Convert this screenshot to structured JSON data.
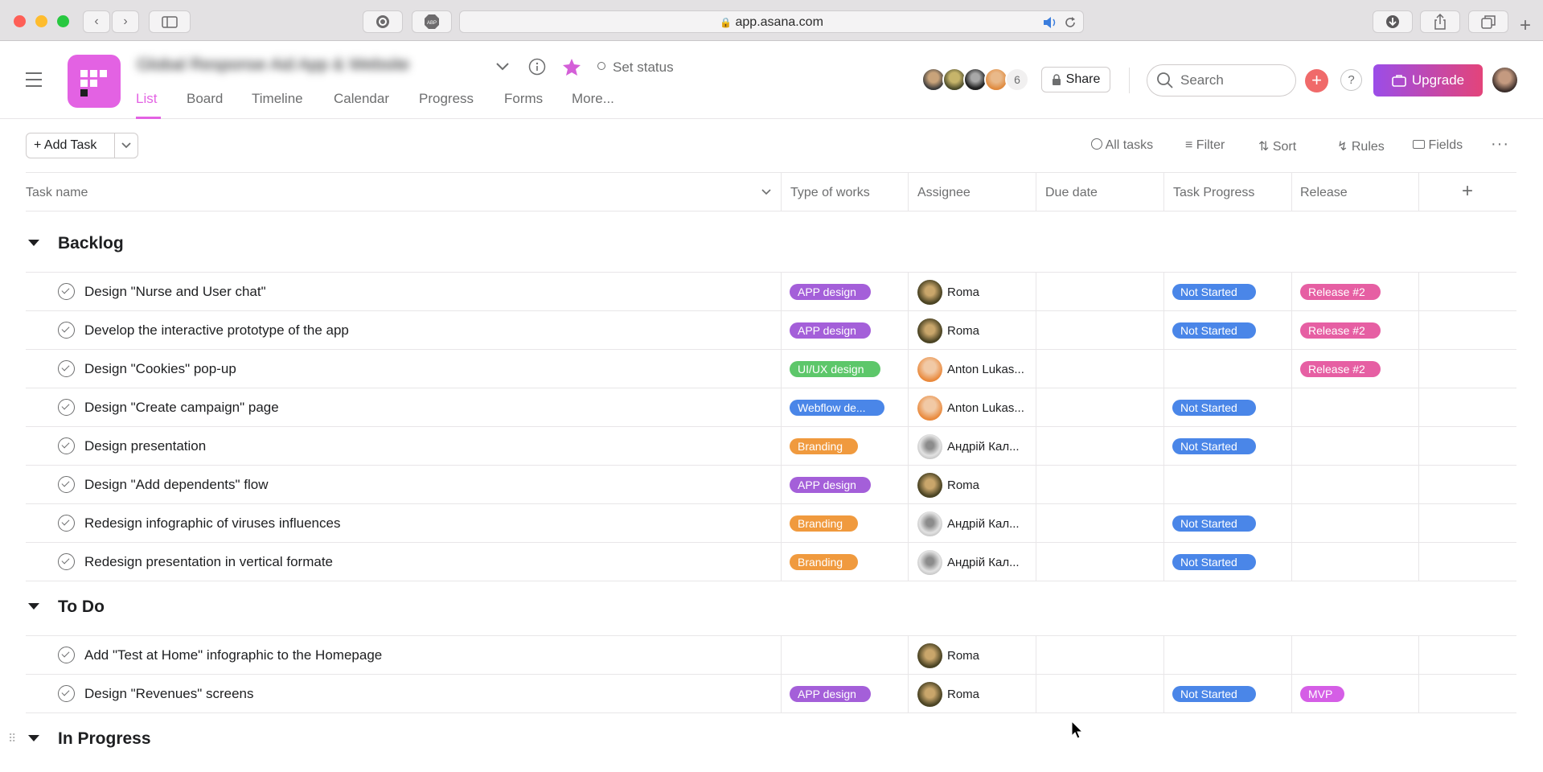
{
  "browser": {
    "url": "app.asana.com",
    "nav": {
      "back": "‹",
      "forward": "›"
    }
  },
  "header": {
    "project_name": "Global Response Aid App & Website",
    "set_status": "Set status",
    "tabs": [
      "List",
      "Board",
      "Timeline",
      "Calendar",
      "Progress",
      "Forms",
      "More..."
    ],
    "active_tab": "List",
    "member_count": "6",
    "share_label": "Share",
    "search_placeholder": "Search",
    "upgrade_label": "Upgrade",
    "help_label": "?"
  },
  "toolbar": {
    "add_task_label": "Add Task",
    "all_tasks": "All tasks",
    "filter": "Filter",
    "sort": "Sort",
    "rules": "Rules",
    "fields": "Fields"
  },
  "columns": [
    "Task name",
    "Type of works",
    "Assignee",
    "Due date",
    "Task Progress",
    "Release"
  ],
  "colors": {
    "accent": "#e362e3",
    "app_design": "#a45fd9",
    "uiux_design": "#5dc76a",
    "webflow_design": "#4a86e8",
    "branding": "#f09a3e",
    "not_started": "#4a86e8",
    "release": "#e65fa3",
    "mvp": "#d55ee6",
    "upgrade_start": "#9b4de8",
    "upgrade_end": "#e3447a"
  },
  "sections": [
    {
      "title": "Backlog",
      "tasks": [
        {
          "name": "Design \"Nurse and User chat\"",
          "type": "APP design",
          "assignee": "Roma",
          "progress": "Not Started",
          "release": "Release #2"
        },
        {
          "name": "Develop the interactive prototype of the app",
          "type": "APP design",
          "assignee": "Roma",
          "progress": "Not Started",
          "release": "Release #2"
        },
        {
          "name": "Design \"Cookies\" pop-up",
          "type": "UI/UX design",
          "assignee": "Anton Lukas...",
          "progress": "",
          "release": "Release #2"
        },
        {
          "name": "Design \"Create campaign\" page",
          "type": "Webflow de...",
          "assignee": "Anton Lukas...",
          "progress": "Not Started",
          "release": ""
        },
        {
          "name": "Design presentation",
          "type": "Branding",
          "assignee": "Андрій Кал...",
          "progress": "Not Started",
          "release": ""
        },
        {
          "name": "Design \"Add dependents\" flow",
          "type": "APP design",
          "assignee": "Roma",
          "progress": "",
          "release": ""
        },
        {
          "name": "Redesign infographic of viruses influences",
          "type": "Branding",
          "assignee": "Андрій Кал...",
          "progress": "Not Started",
          "release": ""
        },
        {
          "name": "Redesign presentation in vertical formate",
          "type": "Branding",
          "assignee": "Андрій Кал...",
          "progress": "Not Started",
          "release": ""
        }
      ]
    },
    {
      "title": "To Do",
      "tasks": [
        {
          "name": "Add \"Test at Home\" infographic to the Homepage",
          "type": "",
          "assignee": "Roma",
          "progress": "",
          "release": ""
        },
        {
          "name": "Design \"Revenues\" screens",
          "type": "APP design",
          "assignee": "Roma",
          "progress": "Not Started",
          "release": "MVP"
        }
      ]
    },
    {
      "title": "In Progress",
      "tasks": []
    }
  ]
}
